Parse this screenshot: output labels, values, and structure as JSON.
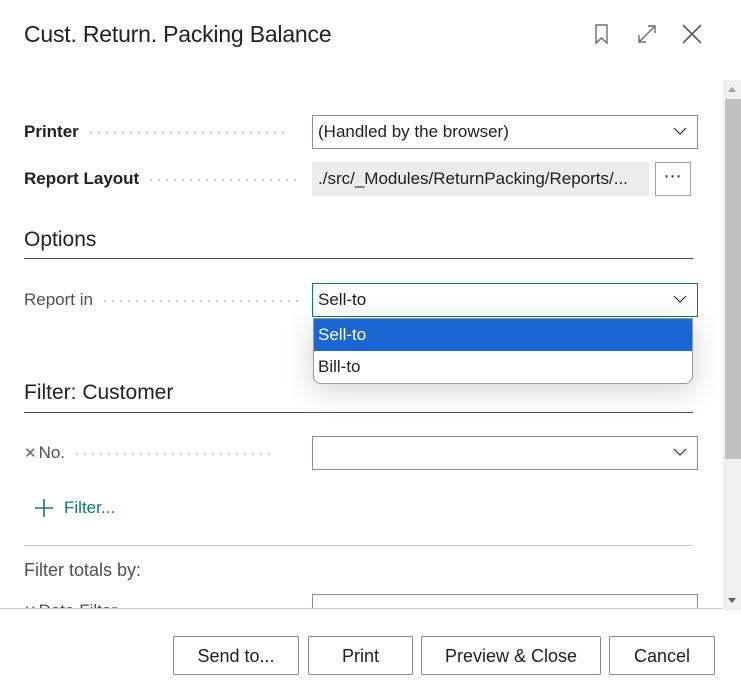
{
  "dialog": {
    "title": "Cust. Return. Packing Balance",
    "header_icons": [
      "bookmark-icon",
      "expand-icon",
      "close-icon"
    ]
  },
  "general": {
    "printer": {
      "label": "Printer",
      "value": "(Handled by the browser)"
    },
    "report_layout": {
      "label": "Report Layout",
      "value": "./src/_Modules/ReturnPacking/Reports/...",
      "more_label": "⋯"
    }
  },
  "options": {
    "title": "Options",
    "report_in": {
      "label": "Report in",
      "value": "Sell-to",
      "options": [
        {
          "label": "Sell-to",
          "selected": true
        },
        {
          "label": "Bill-to",
          "selected": false
        }
      ]
    }
  },
  "filter_customer": {
    "title": "Filter: Customer",
    "fields": [
      {
        "label": "No.",
        "value": ""
      }
    ],
    "add_filter_label": "Filter..."
  },
  "filter_totals": {
    "title": "Filter totals by:",
    "fields": [
      {
        "label": "Date Filter",
        "value": ""
      }
    ]
  },
  "footer": {
    "send_to": "Send to...",
    "print": "Print",
    "preview_close": "Preview & Close",
    "cancel": "Cancel"
  },
  "colors": {
    "accent": "#0f7b76",
    "selected_option": "#1a66d2"
  }
}
